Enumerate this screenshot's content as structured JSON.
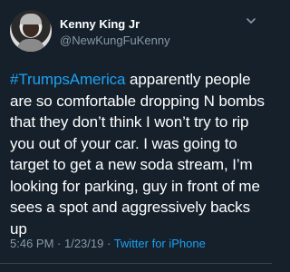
{
  "author": {
    "display_name": "Kenny King Jr",
    "handle": "@NewKungFuKenny"
  },
  "tweet": {
    "hashtag": "#TrumpsAmerica",
    "text": " apparently people are so comfortable dropping N bombs that they don’t think I won’t try to rip you out of your car. I was going to target to get a new soda stream, I’m looking for parking, guy in front of me sees a spot and aggressively backs up",
    "time": "5:46 PM",
    "separator": " · ",
    "date": "1/23/19",
    "source_sep": " · ",
    "source": "Twitter for iPhone"
  },
  "colors": {
    "background": "#15202b",
    "accent": "#1da1f2",
    "secondary_text": "#8899a6"
  },
  "icons": {
    "avatar": "profile-photo",
    "more": "chevron-down-icon"
  }
}
